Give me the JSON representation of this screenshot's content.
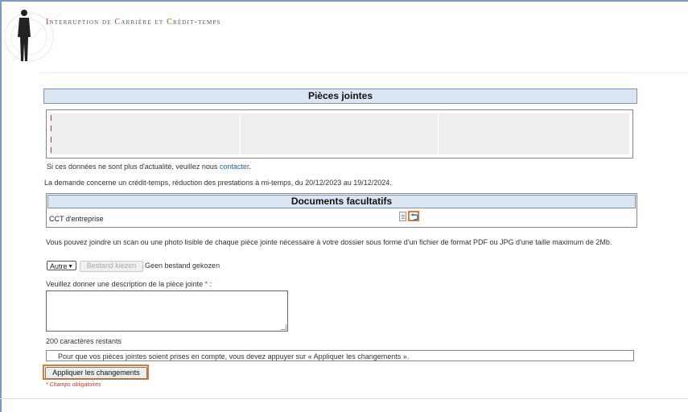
{
  "header": {
    "app_title_parts": [
      {
        "cap": "I",
        "rest": "nterruption"
      },
      {
        "cap": "",
        "rest": " de "
      },
      {
        "cap": "C",
        "rest": "arrière"
      },
      {
        "cap": "",
        "rest": " et "
      },
      {
        "cap": "C",
        "rest": "rédit-temps"
      }
    ],
    "logo_icon": "human-figure-logo-icon"
  },
  "attachments": {
    "section_title": "Pièces jointes",
    "update_text_prefix": "Si ces données ne sont plus d'actualité, veuillez nous ",
    "contact_link": "contacter",
    "update_text_suffix": ".",
    "request_info": "La demande concerne un crédit-temps, réduction des prestations à mi-temps, du 20/12/2023 au 19/12/2024."
  },
  "optional_documents": {
    "section_title": "Documents facultatifs",
    "items": [
      {
        "label": "CCT d'entreprise",
        "document_icon": "document-icon",
        "action_icon": "undo-icon"
      }
    ]
  },
  "upload": {
    "instructions": "Vous pouvez joindre un scan ou une photo lisible de chaque pièce jointe nécessaire à votre dossier sous forme d'un fichier de format PDF ou JPG d'une taille maximum de 2Mb.",
    "type_select": {
      "selected": "Autre"
    },
    "file_button": "Bestand kiezen",
    "file_status": "Geen bestand gekozen",
    "description_label": "Veuillez donner une description de la pièce jointe",
    "required_marker": "*",
    "description_suffix": " :",
    "description_value": "",
    "chars_remaining": "200 caractères restants"
  },
  "notice": "Pour que vos pièces jointes soient prises en compte, vous devez appuyer sur « Appliquer les changements ».",
  "apply_button": "Appliquer les changements",
  "mandatory_note": "* Champs obligatoires",
  "colors": {
    "accent_outline": "#e07b2c",
    "section_header_bg": "#dce6f3",
    "required": "#c0392b"
  }
}
